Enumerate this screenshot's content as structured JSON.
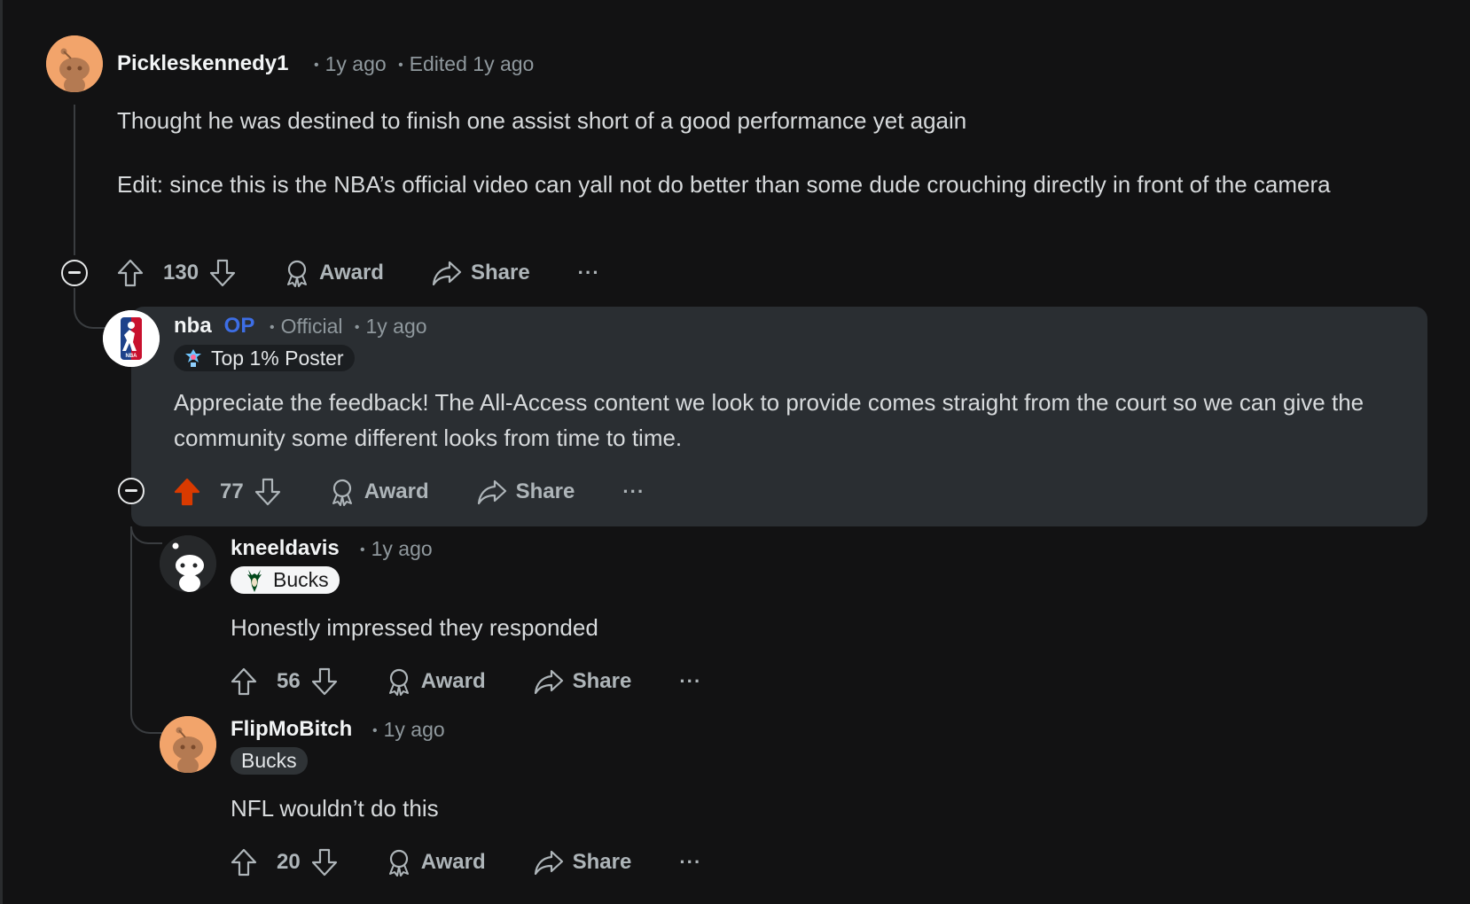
{
  "colors": {
    "background": "#121213",
    "highlight": "#2a2e32",
    "upvote_active": "#d93a00",
    "op_blue": "#3d6ee5",
    "muted": "#8f989d"
  },
  "comments": [
    {
      "username": "Pickleskennedy1",
      "time": "1y ago",
      "edited": "Edited 1y ago",
      "body": "Thought he was destined to finish one assist short of a good performance yet again",
      "body2": "Edit: since this is the NBA’s official video can yall not do better than some dude crouching directly in front of the camera",
      "votes": "130",
      "avatar_icon": "snoo-avatar-icon"
    },
    {
      "username": "nba",
      "op_label": "OP",
      "official": "Official",
      "time": "1y ago",
      "flair": "Top 1% Poster",
      "body": "Appreciate the feedback! The All-Access content we look to provide comes straight from the court so we can give the community some different looks from time to time.",
      "votes": "77",
      "upvoted": true,
      "avatar_icon": "nba-logo-icon"
    },
    {
      "username": "kneeldavis",
      "time": "1y ago",
      "flair": "Bucks",
      "body": "Honestly impressed they responded",
      "votes": "56",
      "avatar_icon": "snoo-avatar-icon"
    },
    {
      "username": "FlipMoBitch",
      "time": "1y ago",
      "flair": "Bucks",
      "body": "NFL wouldn’t do this",
      "votes": "20",
      "avatar_icon": "snoo-avatar-icon"
    }
  ],
  "actions": {
    "award": "Award",
    "share": "Share",
    "more": "···"
  }
}
